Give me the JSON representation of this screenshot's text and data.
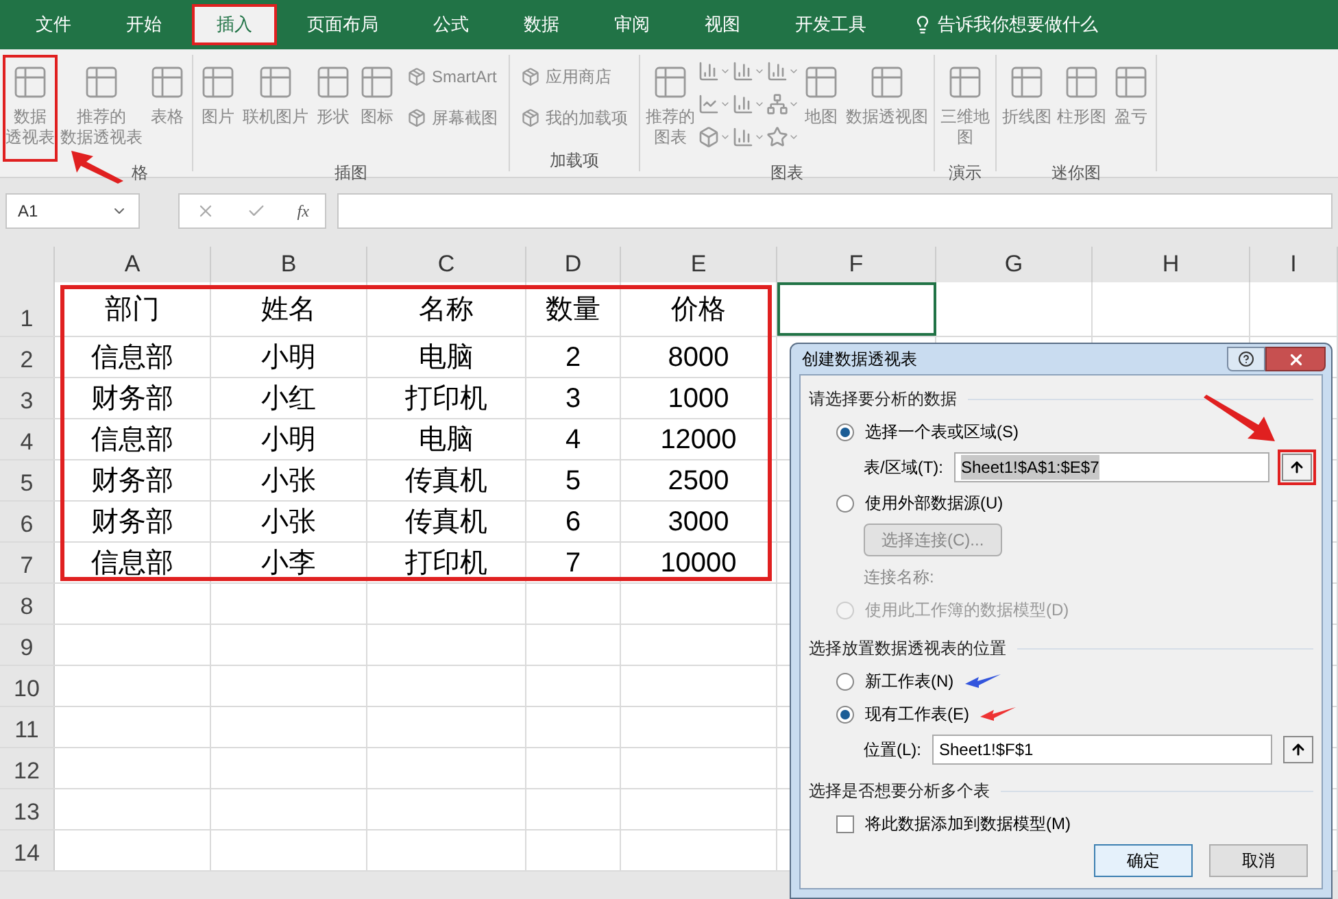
{
  "menu_tabs": [
    {
      "label": "文件",
      "selected": false,
      "annotated": false
    },
    {
      "label": "开始",
      "selected": false,
      "annotated": false
    },
    {
      "label": "插入",
      "selected": true,
      "annotated": true
    },
    {
      "label": "页面布局",
      "selected": false,
      "annotated": false
    },
    {
      "label": "公式",
      "selected": false,
      "annotated": false
    },
    {
      "label": "数据",
      "selected": false,
      "annotated": false
    },
    {
      "label": "审阅",
      "selected": false,
      "annotated": false
    },
    {
      "label": "视图",
      "selected": false,
      "annotated": false
    },
    {
      "label": "开发工具",
      "selected": false,
      "annotated": false
    }
  ],
  "tell_me": "告诉我你想要做什么",
  "ribbon_groups": [
    {
      "label": "格",
      "items": [
        {
          "kind": "large",
          "lines": [
            "数据",
            "透视表"
          ],
          "annotated": true
        },
        {
          "kind": "large",
          "lines": [
            "推荐的",
            "数据透视表"
          ],
          "annotated": false
        },
        {
          "kind": "large",
          "lines": [
            "表格"
          ],
          "annotated": false
        }
      ]
    },
    {
      "label": "插图",
      "items": [
        {
          "kind": "large",
          "lines": [
            "图片"
          ],
          "annotated": false
        },
        {
          "kind": "large",
          "lines": [
            "联机图片"
          ],
          "annotated": false
        },
        {
          "kind": "large",
          "lines": [
            "形状"
          ],
          "annotated": false
        },
        {
          "kind": "large",
          "lines": [
            "图标"
          ],
          "annotated": false
        },
        {
          "kind": "small",
          "label": "SmartArt",
          "annotated": false
        },
        {
          "kind": "small",
          "label": "屏幕截图",
          "annotated": false
        }
      ]
    },
    {
      "label": "加载项",
      "items": [
        {
          "kind": "small",
          "label": "应用商店",
          "annotated": false
        },
        {
          "kind": "small",
          "label": "我的加载项",
          "annotated": false
        }
      ]
    },
    {
      "label": "图表",
      "items": [
        {
          "kind": "large",
          "lines": [
            "推荐的",
            "图表"
          ],
          "annotated": false
        },
        {
          "kind": "grid"
        },
        {
          "kind": "large",
          "lines": [
            "地图"
          ],
          "annotated": false
        },
        {
          "kind": "large",
          "lines": [
            "数据透视图"
          ],
          "annotated": false
        }
      ]
    },
    {
      "label": "演示",
      "items": [
        {
          "kind": "large",
          "lines": [
            "三维地",
            "图"
          ],
          "annotated": false
        }
      ]
    },
    {
      "label": "迷你图",
      "items": [
        {
          "kind": "large",
          "lines": [
            "折线图"
          ],
          "annotated": false
        },
        {
          "kind": "large",
          "lines": [
            "柱形图"
          ],
          "annotated": false
        },
        {
          "kind": "large",
          "lines": [
            "盈亏"
          ],
          "annotated": false
        }
      ]
    }
  ],
  "name_box": "A1",
  "function_label": "fx",
  "columns": [
    "A",
    "B",
    "C",
    "D",
    "E",
    "F",
    "G",
    "H",
    "I"
  ],
  "row_numbers": [
    "1",
    "2",
    "3",
    "4",
    "5",
    "6",
    "7",
    "8",
    "9",
    "10",
    "11",
    "12",
    "13",
    "14"
  ],
  "table": {
    "rows": [
      [
        "部门",
        "姓名",
        "名称",
        "数量",
        "价格"
      ],
      [
        "信息部",
        "小明",
        "电脑",
        "2",
        "8000"
      ],
      [
        "财务部",
        "小红",
        "打印机",
        "3",
        "1000"
      ],
      [
        "信息部",
        "小明",
        "电脑",
        "4",
        "12000"
      ],
      [
        "财务部",
        "小张",
        "传真机",
        "5",
        "2500"
      ],
      [
        "财务部",
        "小张",
        "传真机",
        "6",
        "3000"
      ],
      [
        "信息部",
        "小李",
        "打印机",
        "7",
        "10000"
      ]
    ]
  },
  "dialog": {
    "title": "创建数据透视表",
    "section_1": "请选择要分析的数据",
    "source_options": [
      {
        "label": "选择一个表或区域(S)",
        "selected": true,
        "disabled": false
      },
      {
        "label": "使用外部数据源(U)",
        "selected": false,
        "disabled": false
      }
    ],
    "range_label": "表/区域(T):",
    "range_value": "Sheet1!$A$1:$E$7",
    "choose_connection": "选择连接(C)...",
    "connection_name": "连接名称:",
    "model_option": {
      "label": "使用此工作簿的数据模型(D)",
      "selected": false,
      "disabled": true
    },
    "section_2": "选择放置数据透视表的位置",
    "location_options": [
      {
        "label": "新工作表(N)",
        "selected": false
      },
      {
        "label": "现有工作表(E)",
        "selected": true
      }
    ],
    "location_label": "位置(L):",
    "location_value": "Sheet1!$F$1",
    "section_3": "选择是否想要分析多个表",
    "add_to_model": {
      "label": "将此数据添加到数据模型(M)",
      "checked": false
    },
    "ok": "确定",
    "cancel": "取消"
  }
}
